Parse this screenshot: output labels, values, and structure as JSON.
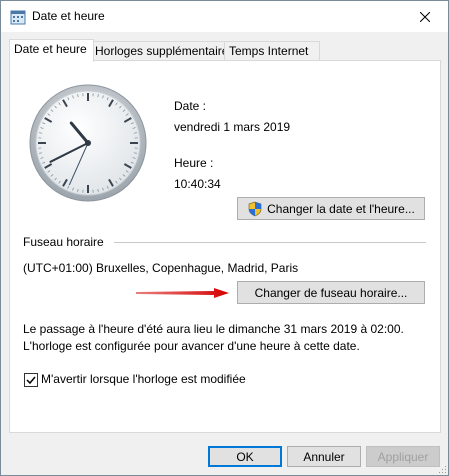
{
  "window": {
    "title": "Date et heure"
  },
  "tabs": [
    {
      "label": "Date et heure"
    },
    {
      "label": "Horloges supplémentaires"
    },
    {
      "label": "Temps Internet"
    }
  ],
  "datetime": {
    "date_label": "Date :",
    "date_value": "vendredi 1 mars 2019",
    "time_label": "Heure :",
    "time_value": "10:40:34",
    "change_datetime_button": "Changer la date et l'heure..."
  },
  "timezone": {
    "section_label": "Fuseau horaire",
    "value": "(UTC+01:00) Bruxelles, Copenhague, Madrid, Paris",
    "change_button": "Changer de fuseau horaire..."
  },
  "dst": {
    "line1": "Le passage à l'heure d'été aura lieu le dimanche 31 mars 2019 à 02:00.",
    "line2": "L'horloge est configurée pour avancer d'une heure à cette date."
  },
  "notify": {
    "label": "M'avertir lorsque l'horloge est modifiée",
    "checked": true
  },
  "footer": {
    "ok": "OK",
    "cancel": "Annuler",
    "apply": "Appliquer"
  },
  "clock": {
    "hour": 10,
    "minute": 40,
    "second": 34
  },
  "colors": {
    "accent": "#0078d7",
    "arrow": "#d40000"
  }
}
